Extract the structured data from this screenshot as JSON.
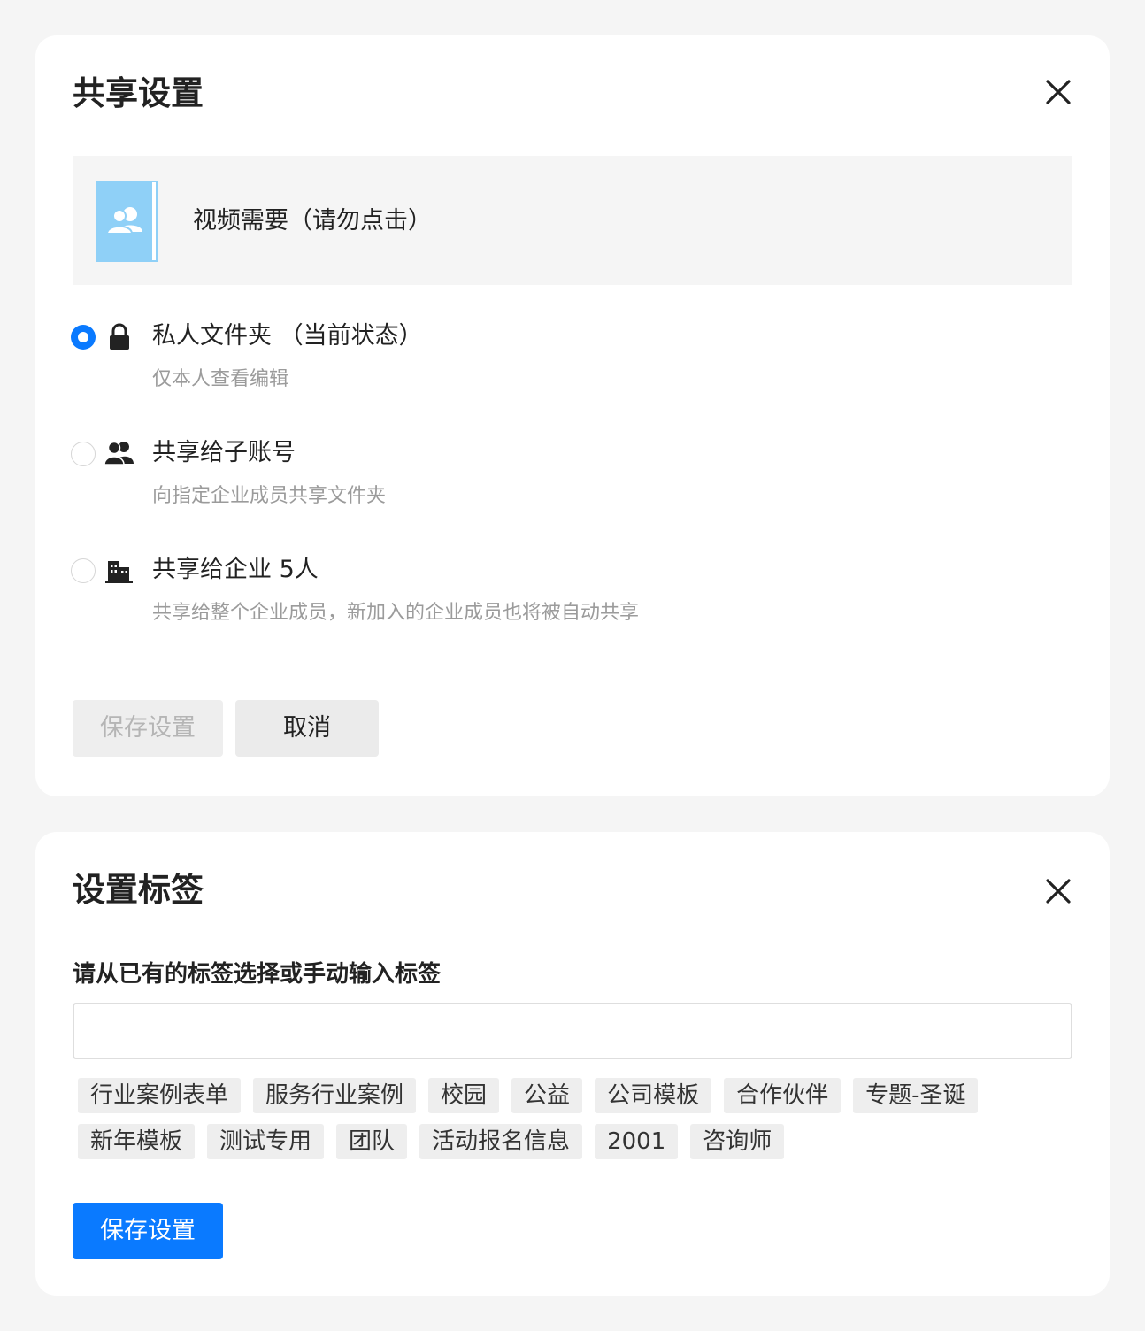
{
  "share_dialog": {
    "title": "共享设置",
    "folder_name": "视频需要（请勿点击）",
    "options": [
      {
        "label": "私人文件夹 （当前状态）",
        "desc": "仅本人查看编辑",
        "checked": true,
        "icon": "lock-icon"
      },
      {
        "label": "共享给子账号",
        "desc": "向指定企业成员共享文件夹",
        "checked": false,
        "icon": "users-icon"
      },
      {
        "label": "共享给企业 5人",
        "desc": "共享给整个企业成员，新加入的企业成员也将被自动共享",
        "checked": false,
        "icon": "building-icon"
      }
    ],
    "save_label": "保存设置",
    "cancel_label": "取消"
  },
  "tag_dialog": {
    "title": "设置标签",
    "prompt": "请从已有的标签选择或手动输入标签",
    "input_value": "",
    "tags_row1": [
      "行业案例表单",
      "服务行业案例",
      "校园",
      "公益",
      "公司模板",
      "合作伙伴",
      "专题-圣诞"
    ],
    "tags_row2": [
      "新年模板",
      "测试专用",
      "团队",
      "活动报名信息",
      "2001",
      "咨询师"
    ],
    "save_label": "保存设置"
  },
  "colors": {
    "primary": "#0a7aff",
    "folder_icon": "#8fd0f7",
    "page_bg": "#f5f5f5"
  }
}
